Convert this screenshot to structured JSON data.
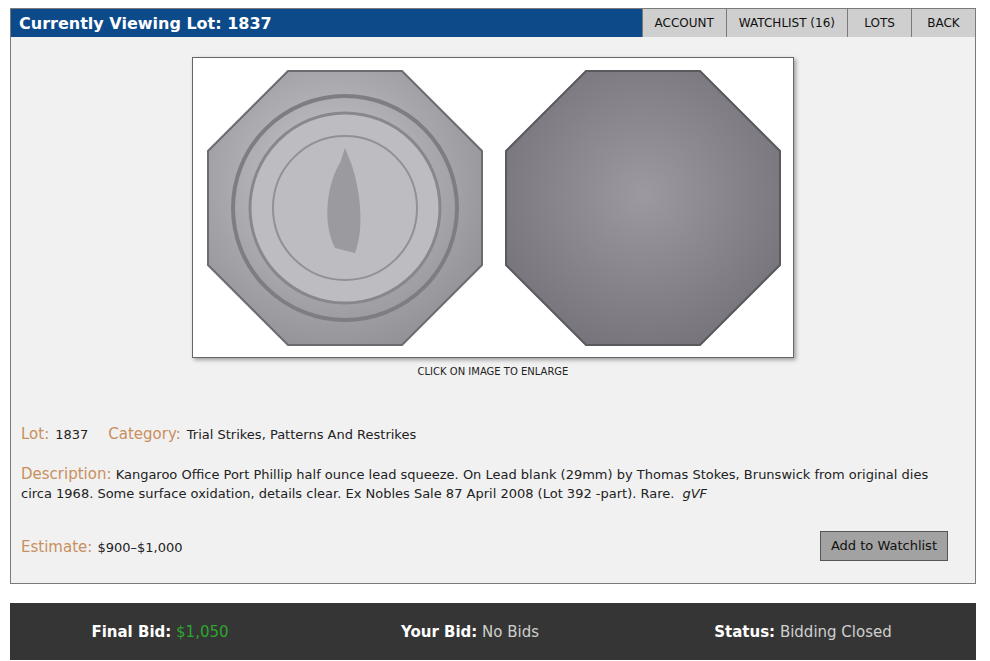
{
  "header": {
    "title": "Currently Viewing Lot: 1837"
  },
  "nav": [
    {
      "label": "ACCOUNT"
    },
    {
      "label": "WATCHLIST (16)"
    },
    {
      "label": "LOTS"
    },
    {
      "label": "BACK"
    }
  ],
  "image": {
    "caption": "CLICK ON IMAGE TO ENLARGE"
  },
  "details": {
    "lot_label": "Lot:",
    "lot": "1837",
    "category_label": "Category:",
    "category": "Trial Strikes, Patterns And Restrikes",
    "description_label": "Description:",
    "description": "Kangaroo Office Port Phillip half ounce lead squeeze. On Lead blank (29mm) by Thomas Stokes, Brunswick from original dies circa 1968. Some surface oxidation, details clear. Ex Nobles Sale 87 April 2008 (Lot 392 -part). Rare.",
    "grade": "gVF",
    "estimate_label": "Estimate:",
    "estimate": "$900–$1,000"
  },
  "watch_button": "Add to Watchlist",
  "bid_bar": [
    {
      "label": "Final Bid:",
      "value": "$1,050",
      "color": "#2fa52f"
    },
    {
      "label": "Your Bid:",
      "value": "No Bids",
      "color": "#cfcfcf"
    },
    {
      "label": "Status:",
      "value": "Bidding Closed",
      "color": "#cfcfcf"
    }
  ]
}
